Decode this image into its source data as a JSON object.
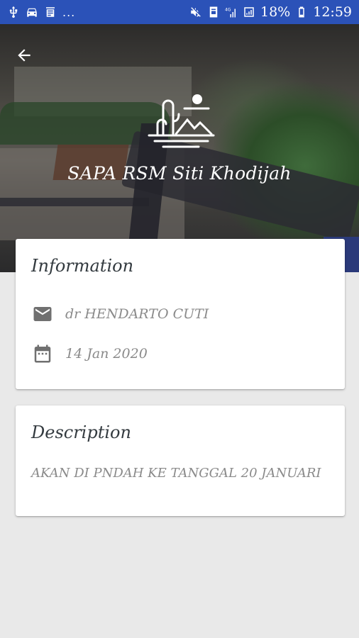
{
  "status_bar": {
    "left_icons": [
      "usb-icon",
      "car-icon",
      "news-icon"
    ],
    "dots": "...",
    "network": "4G",
    "battery_text": "18%",
    "time": "12:59"
  },
  "header": {
    "title": "SAPA RSM Siti Khodijah",
    "back_icon": "arrow-left-icon",
    "logo_icon": "landscape-logo-icon"
  },
  "information": {
    "title": "Information",
    "email_text": "dr HENDARTO CUTI",
    "date_text": "14 Jan 2020"
  },
  "description": {
    "title": "Description",
    "text": "AKAN DI PNDAH KE TANGGAL 20 JANUARI"
  },
  "colors": {
    "status_bar": "#2b52b8",
    "background": "#e9e9e9",
    "card": "#ffffff",
    "title_text": "#333a3f",
    "body_text": "#8a8a8a"
  }
}
